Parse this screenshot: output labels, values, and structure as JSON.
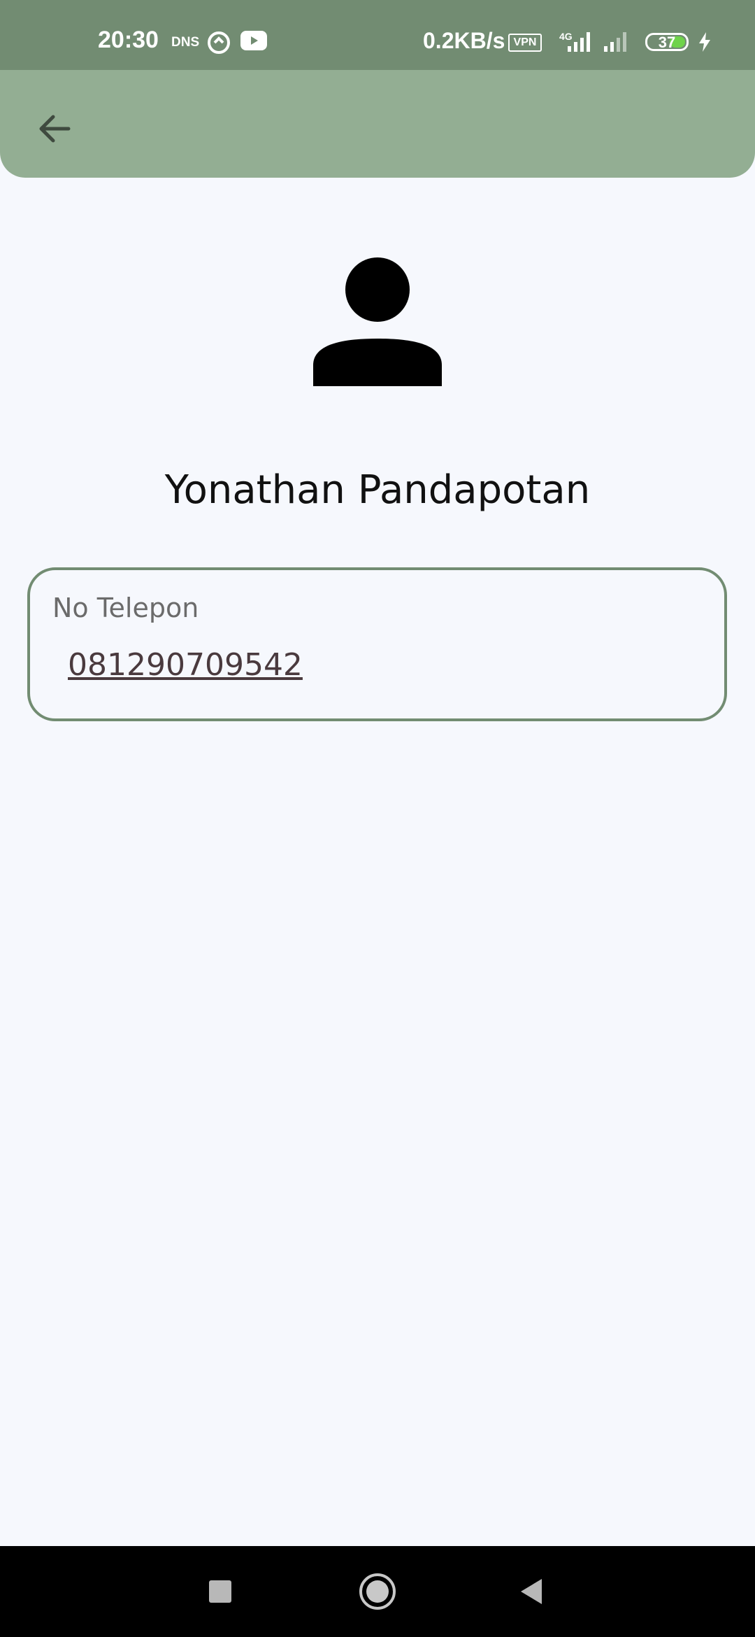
{
  "status_bar": {
    "time": "20:30",
    "dns_label": "DNS",
    "net_speed": "0.2KB/s",
    "vpn_label": "VPN",
    "network_type": "4G",
    "battery_level": "37",
    "background_color": "#728c72"
  },
  "app_bar": {
    "background_color": "#93ae93",
    "back_icon": "arrow-left-icon"
  },
  "profile": {
    "avatar_icon": "person-icon",
    "name": "Yonathan Pandapotan"
  },
  "phone_card": {
    "label": "No Telepon",
    "value": "081290709542",
    "border_color": "#728c72"
  },
  "nav_bar": {
    "recents_icon": "square-icon",
    "home_icon": "circle-icon",
    "back_icon": "triangle-back-icon"
  }
}
